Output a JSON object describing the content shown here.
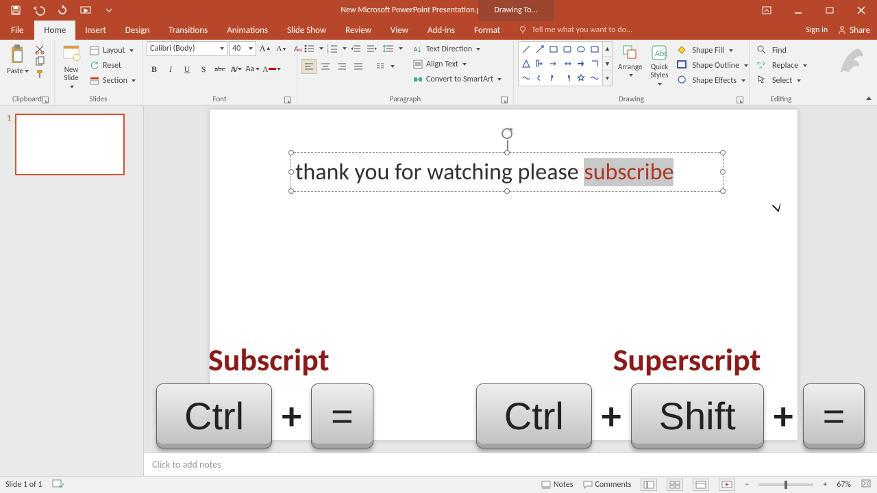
{
  "title_bar": {
    "document_title": "New Microsoft PowerPoint Presentation.pptx - PowerPoint",
    "contextual_tab_group": "Drawing To..."
  },
  "tabs": {
    "file": "File",
    "home": "Home",
    "insert": "Insert",
    "design": "Design",
    "transitions": "Transitions",
    "animations": "Animations",
    "slide_show": "Slide Show",
    "review": "Review",
    "view": "View",
    "addins": "Add-ins",
    "format": "Format",
    "tell_me_placeholder": "Tell me what you want to do...",
    "sign_in": "Sign in",
    "share": "Share"
  },
  "ribbon": {
    "clipboard": {
      "paste": "Paste",
      "group_label": "Clipboard"
    },
    "slides": {
      "new_slide": "New\nSlide",
      "layout": "Layout",
      "reset": "Reset",
      "section": "Section",
      "group_label": "Slides"
    },
    "font": {
      "font_name": "Calibri (Body)",
      "font_size": "40",
      "b": "B",
      "i": "I",
      "u": "U",
      "s": "S",
      "strike": "abc",
      "group_label": "Font"
    },
    "paragraph": {
      "text_direction": "Text Direction",
      "align_text": "Align Text",
      "convert_smartart": "Convert to SmartArt",
      "group_label": "Paragraph"
    },
    "drawing": {
      "arrange": "Arrange",
      "quick_styles": "Quick\nStyles",
      "shape_fill": "Shape Fill",
      "shape_outline": "Shape Outline",
      "shape_effects": "Shape Effects",
      "group_label": "Drawing"
    },
    "editing": {
      "find": "Find",
      "replace": "Replace",
      "select": "Select",
      "group_label": "Editing"
    }
  },
  "thumbnails": {
    "slide1_number": "1"
  },
  "slide": {
    "text_prefix": "thank you for watching please ",
    "text_selected": "subscribe"
  },
  "overlay": {
    "subscript_label": "Subscript",
    "superscript_label": "Superscript",
    "key_ctrl": "Ctrl",
    "key_shift": "Shift",
    "key_equals": "=",
    "plus": "+"
  },
  "notes": {
    "placeholder": "Click to add notes"
  },
  "status": {
    "slide_counter": "Slide 1 of 1",
    "notes": "Notes",
    "comments": "Comments",
    "zoom_pct": "67%",
    "minus": "−",
    "plus": "+"
  }
}
